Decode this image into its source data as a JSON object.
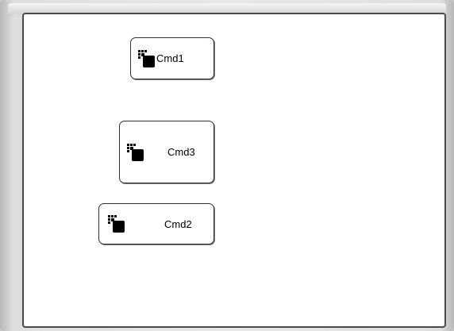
{
  "buttons": [
    {
      "id": "cmd1",
      "label": "Cmd1",
      "icon": "app-stack-icon"
    },
    {
      "id": "cmd3",
      "label": "Cmd3",
      "icon": "app-stack-icon"
    },
    {
      "id": "cmd2",
      "label": "Cmd2",
      "icon": "app-stack-icon"
    }
  ],
  "colors": {
    "client_background": "#ffffff",
    "button_border": "#333333",
    "frame": "#d8d8d8"
  }
}
